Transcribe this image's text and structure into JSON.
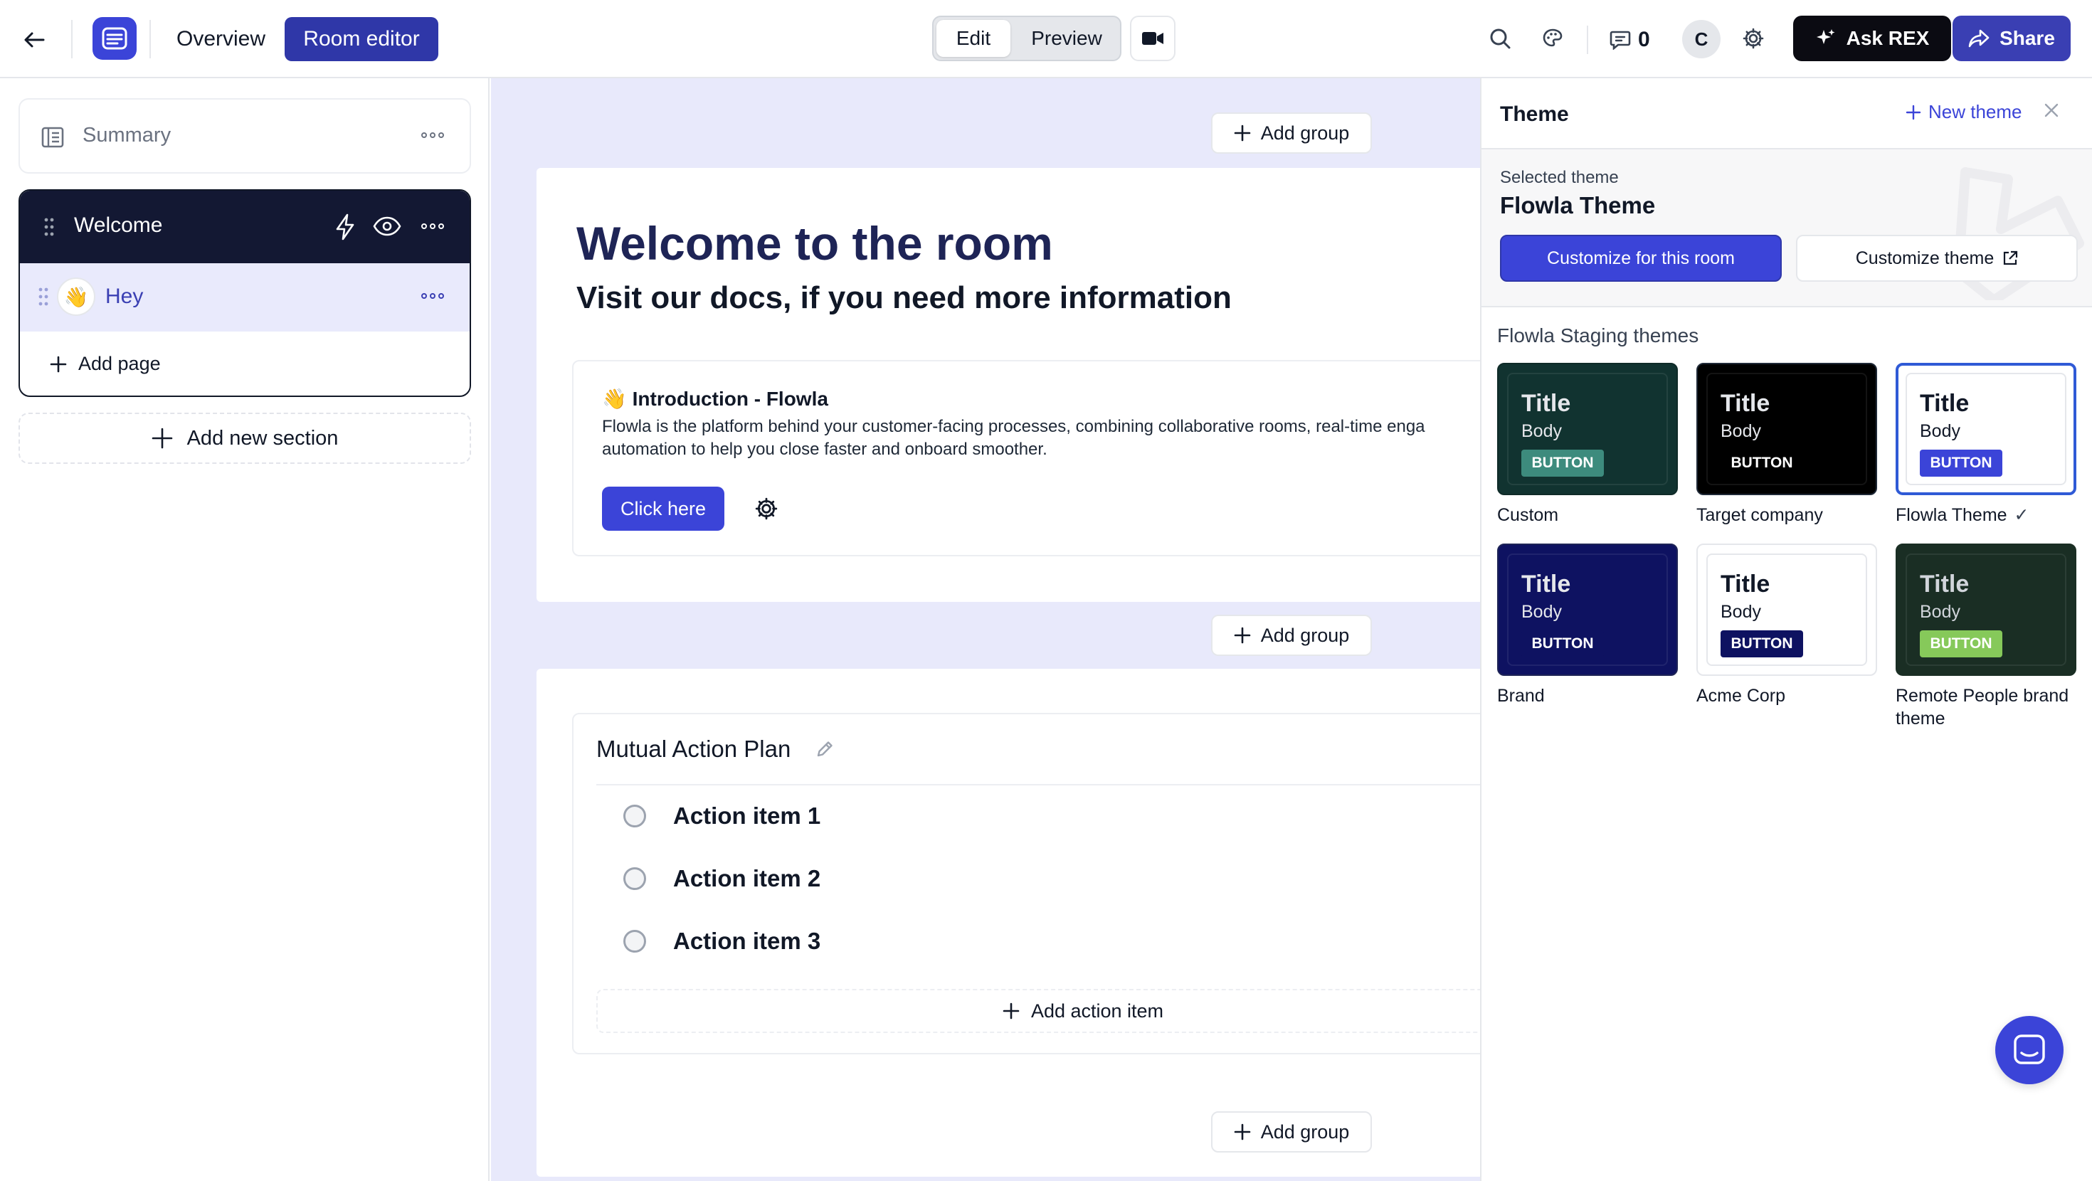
{
  "topbar": {
    "nav": {
      "overview": "Overview",
      "room_editor": "Room editor"
    },
    "mode": {
      "edit": "Edit",
      "preview": "Preview"
    },
    "comment_count": "0",
    "avatar_initial": "C",
    "ask_rex": "Ask REX",
    "share": "Share"
  },
  "sidebar": {
    "summary_label": "Summary",
    "section": {
      "title": "Welcome",
      "page": {
        "emoji": "👋",
        "title": "Hey"
      },
      "add_page": "Add page"
    },
    "add_section": "Add new section"
  },
  "canvas": {
    "add_group": "Add group",
    "welcome": {
      "title": "Welcome to the room",
      "subtitle": "Visit our docs, if you need more information"
    },
    "intro": {
      "title": "👋 Introduction - Flowla",
      "text_line1": "Flowla is the platform behind your customer-facing processes, combining collaborative rooms, real-time enga",
      "text_line2": "automation to help you close faster and onboard smoother.",
      "button": "Click here"
    },
    "map": {
      "title": "Mutual Action Plan",
      "items": [
        "Action item 1",
        "Action item 2",
        "Action item 3"
      ],
      "add_action": "Add action item"
    }
  },
  "theme_panel": {
    "title": "Theme",
    "new_theme": "New theme",
    "selected_label": "Selected theme",
    "selected_name": "Flowla Theme",
    "customize_room": "Customize for this room",
    "customize_theme": "Customize theme",
    "staging_label": "Flowla Staging themes",
    "sample": {
      "title": "Title",
      "body": "Body",
      "button": "BUTTON"
    },
    "themes": [
      {
        "name": "Custom",
        "bg": "#113330",
        "fg": "#e5e7eb",
        "btn_bg": "#3d8b7d",
        "btn_fg": "#ffffff",
        "border": "#0f2b28",
        "selected": false
      },
      {
        "name": "Target company",
        "bg": "#000000",
        "fg": "#e5e7eb",
        "btn_bg": "#000000",
        "btn_fg": "#ffffff",
        "border": "#1f2937",
        "selected": false
      },
      {
        "name": "Flowla Theme",
        "name_suffix": "✓",
        "bg": "#ffffff",
        "fg": "#111827",
        "btn_bg": "#3b44d8",
        "btn_fg": "#ffffff",
        "border": "#2f5ad6",
        "selected": true
      },
      {
        "name": "Brand",
        "bg": "#0e1261",
        "fg": "#e5e7eb",
        "btn_bg": "#0e1261",
        "btn_fg": "#ffffff",
        "border": "#1e2456",
        "selected": false
      },
      {
        "name": "Acme Corp",
        "bg": "#ffffff",
        "fg": "#111827",
        "btn_bg": "#0e1261",
        "btn_fg": "#ffffff",
        "border": "#e5e7eb",
        "selected": false
      },
      {
        "name": "Remote People brand theme",
        "bg": "#1a2e24",
        "fg": "#d1d5db",
        "btn_bg": "#86c95a",
        "btn_fg": "#ffffff",
        "border": "#1a2e24",
        "selected": false
      }
    ]
  },
  "colors": {
    "accent": "#3b44d8",
    "dark": "#131833",
    "canvas_bg": "#e8e9fb"
  }
}
